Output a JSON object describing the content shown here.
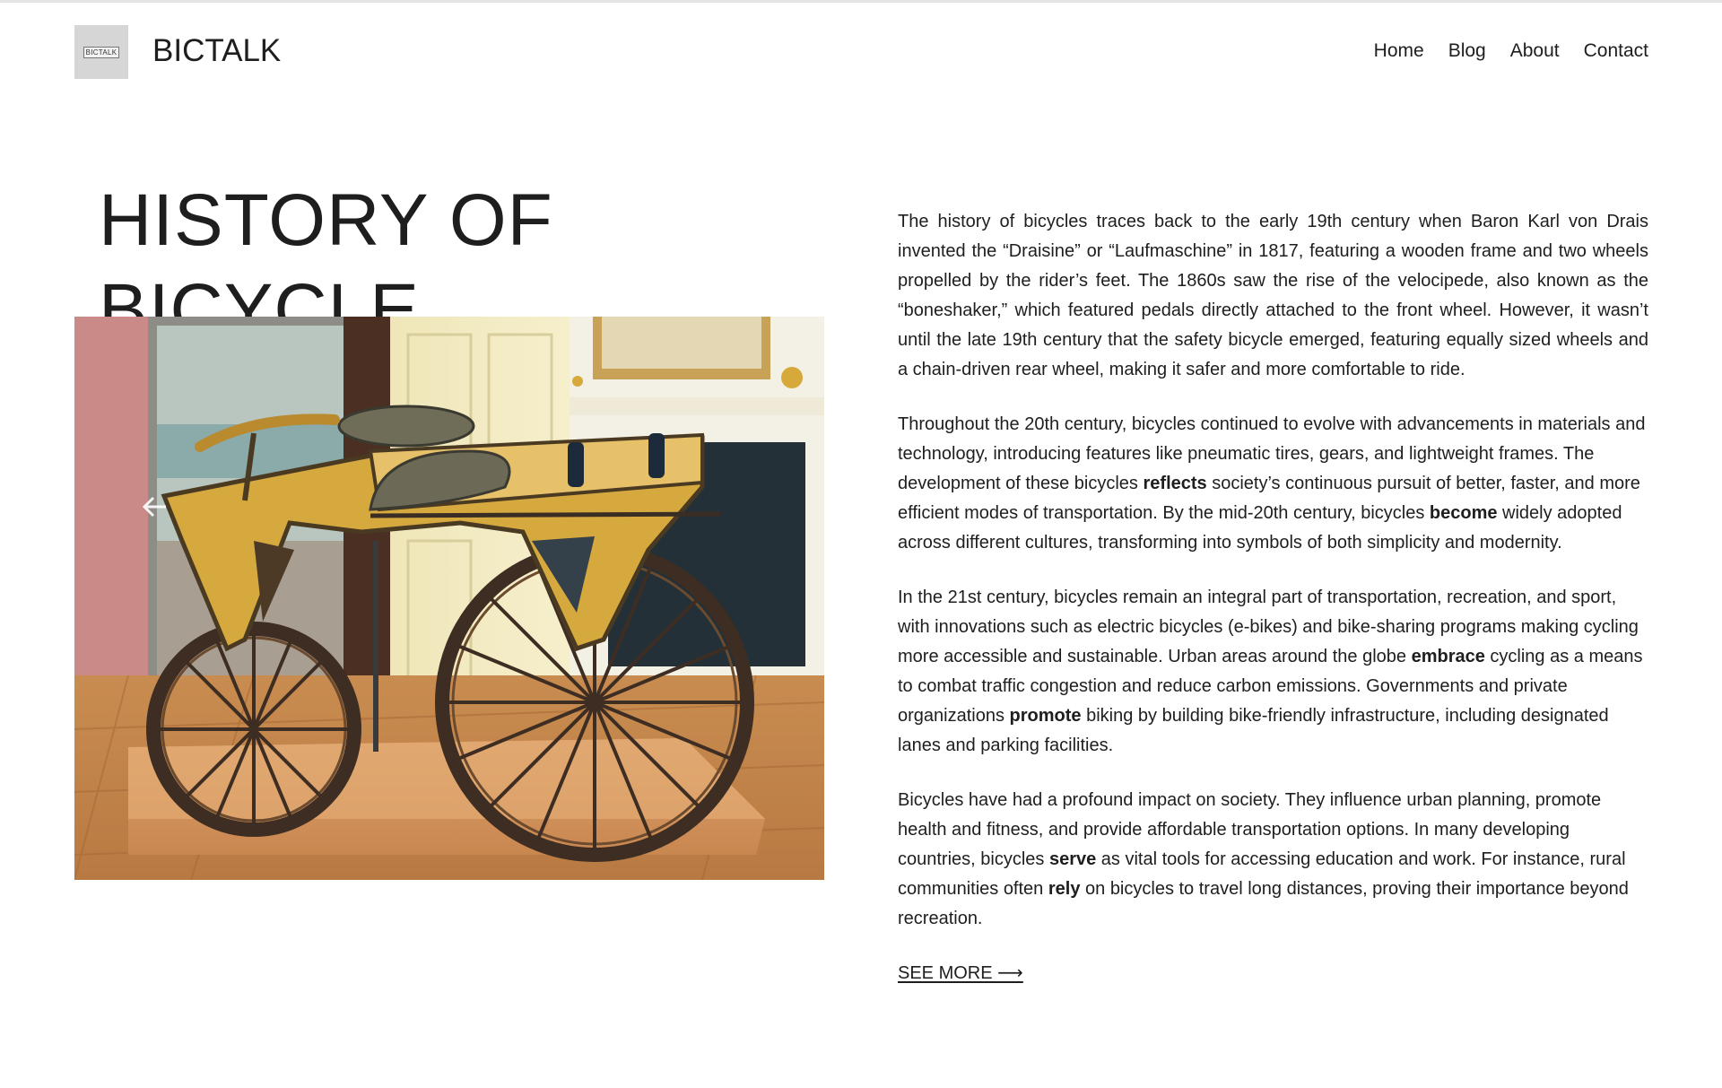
{
  "header": {
    "logo_text": "BICTALK",
    "site_title": "BICTALK",
    "nav": [
      {
        "label": "Home"
      },
      {
        "label": "Blog"
      },
      {
        "label": "About"
      },
      {
        "label": "Contact"
      }
    ]
  },
  "main": {
    "title": "HISTORY OF BICYCLE",
    "image": {
      "subject": "early wooden draisine (Laufmaschine) displayed on a wooden base in a museum room",
      "icon": "left-arrow-icon"
    },
    "paragraphs": [
      {
        "segments": [
          {
            "text": "The history of bicycles traces back to the early 19th century when Baron Karl von Drais invented the “Draisine” or “Laufmaschine” in 1817, featuring a wooden frame and two wheels propelled by the rider’s feet. The 1860s saw the rise of the velocipede, also known as the “boneshaker,” which featured pedals directly attached to the front wheel. However, it wasn’t until the late 19th century that the safety bicycle emerged, featuring equally sized wheels and a chain-driven rear wheel, making it safer and more comfortable to ride."
          }
        ]
      },
      {
        "segments": [
          {
            "text": "Throughout the 20th century, bicycles continued to evolve with advancements in materials and technology, introducing features like pneumatic tires, gears, and lightweight frames. The development of these bicycles "
          },
          {
            "bold": "reflects"
          },
          {
            "text": " society’s continuous pursuit of better, faster, and more efficient modes of transportation. By the mid-20th century, bicycles "
          },
          {
            "bold": "become"
          },
          {
            "text": " widely adopted across different cultures, transforming into symbols of both simplicity and modernity."
          }
        ]
      },
      {
        "segments": [
          {
            "text": "In the 21st century, bicycles remain an integral part of transportation, recreation, and sport, with innovations such as electric bicycles (e-bikes) and bike-sharing programs making cycling more accessible and sustainable. Urban areas around the globe "
          },
          {
            "bold": "embrace"
          },
          {
            "text": " cycling as a means to combat traffic congestion and reduce carbon emissions. Governments and private organizations "
          },
          {
            "bold": "promote"
          },
          {
            "text": " biking by building bike-friendly infrastructure, including designated lanes and parking facilities."
          }
        ]
      },
      {
        "segments": [
          {
            "text": "Bicycles have had a profound impact on society. They influence urban planning, promote health and fitness, and provide affordable transportation options. In many developing countries, bicycles "
          },
          {
            "bold": "serve"
          },
          {
            "text": " as vital tools for accessing education and work. For instance, rural communities often "
          },
          {
            "bold": "rely"
          },
          {
            "text": " on bicycles to travel long distances, proving their importance beyond recreation."
          }
        ]
      }
    ],
    "see_more_label": "SEE MORE ⟶"
  },
  "colors": {
    "text": "#1e1e1e",
    "logo_bg": "#d6d6d6",
    "topline": "#e4e4e4"
  }
}
